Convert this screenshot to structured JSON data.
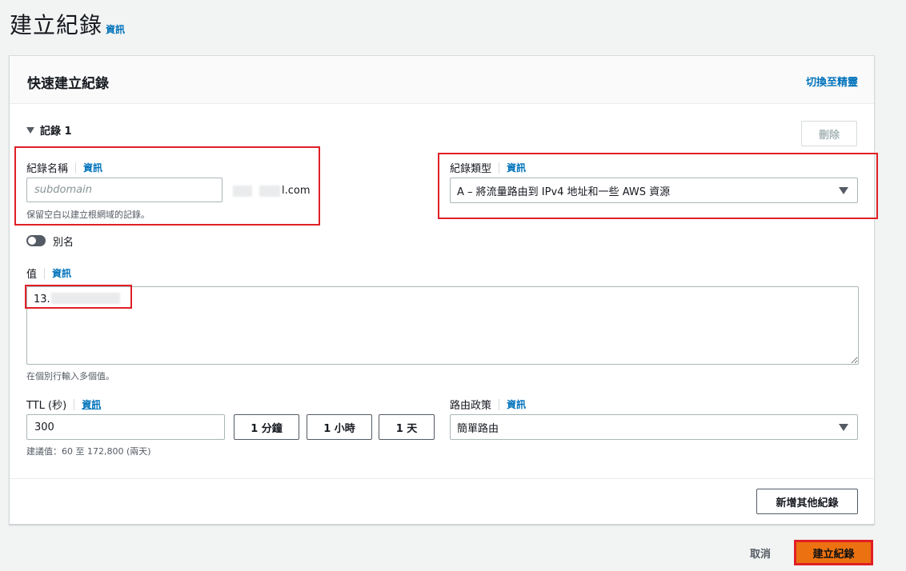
{
  "page": {
    "title": "建立紀錄",
    "info_link": "資訊"
  },
  "panel": {
    "title": "快速建立紀錄",
    "switch_link": "切換至精靈"
  },
  "record": {
    "toggle_label": "記錄 1",
    "delete_label": "刪除",
    "name": {
      "label": "紀錄名稱",
      "info": "資訊",
      "placeholder": "subdomain",
      "domain_suffix": "l.com",
      "hint": "保留空白以建立根網域的記錄。"
    },
    "type": {
      "label": "紀錄類型",
      "info": "資訊",
      "selected": "A – 將流量路由到 IPv4 地址和一些 AWS 資源"
    },
    "alias": {
      "label": "別名",
      "enabled": false
    },
    "value": {
      "label": "值",
      "info": "資訊",
      "content": "13.",
      "hint": "在個別行輸入多個值。"
    },
    "ttl": {
      "label": "TTL (秒)",
      "info": "資訊",
      "value": "300",
      "presets": [
        "1 分鐘",
        "1 小時",
        "1 天"
      ],
      "hint": "建議值：60 至 172,800 (兩天)"
    },
    "routing": {
      "label": "路由政策",
      "info": "資訊",
      "selected": "簡單路由"
    },
    "add_another_label": "新增其他紀錄"
  },
  "footer": {
    "cancel_label": "取消",
    "create_label": "建立紀錄"
  },
  "colors": {
    "accent": "#ec7211",
    "link": "#0073bb",
    "highlight": "#e01f26"
  }
}
